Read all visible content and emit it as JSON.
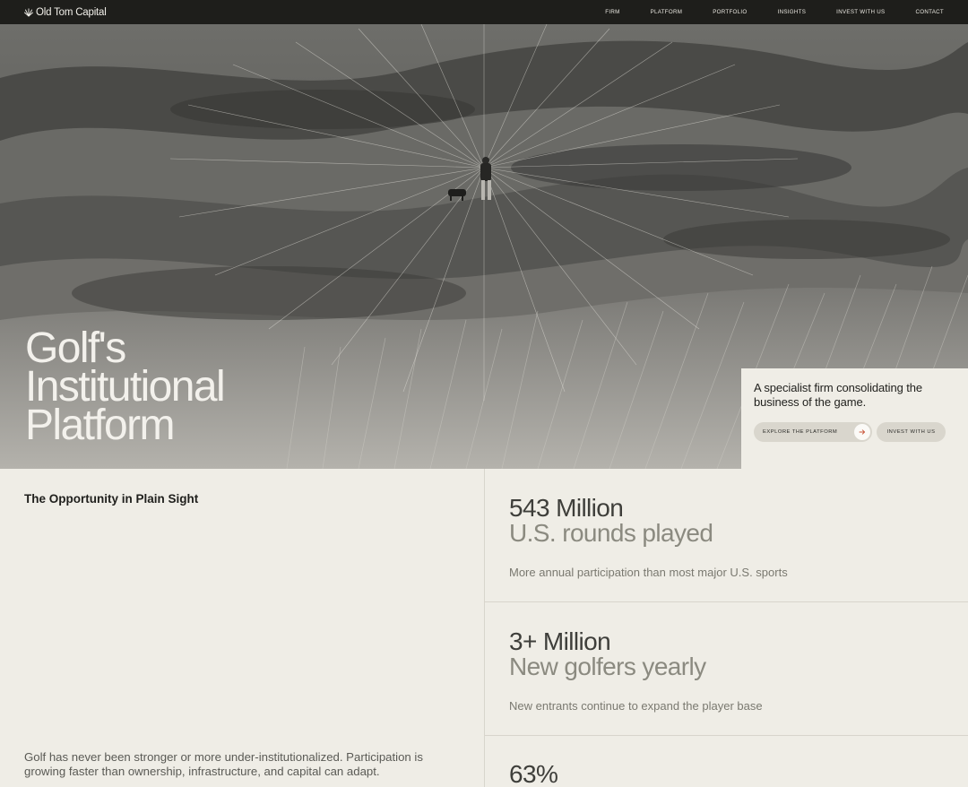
{
  "brand": {
    "name": "Old Tom Capital",
    "icon": "starburst-icon"
  },
  "nav": {
    "items": [
      {
        "label": "FIRM"
      },
      {
        "label": "PLATFORM"
      },
      {
        "label": "PORTFOLIO"
      },
      {
        "label": "INSIGHTS"
      },
      {
        "label": "INVEST WITH US"
      },
      {
        "label": "CONTACT"
      }
    ]
  },
  "hero": {
    "title_lines": [
      "Golf's",
      "Institutional",
      "Platform"
    ],
    "tagline": "A specialist firm consolidating the business of the game.",
    "explore_label": "EXPLORE THE PLATFORM",
    "invest_label": "INVEST WITH US"
  },
  "opportunity": {
    "label": "The Opportunity in Plain Sight",
    "body": "Golf has never been stronger or more under-institutionalized. Participation is growing faster than ownership, infrastructure, and capital can adapt."
  },
  "stats": [
    {
      "value": "543 Million",
      "caption": "U.S. rounds played",
      "description": "More annual participation than most major U.S. sports"
    },
    {
      "value": "3+ Million",
      "caption": "New golfers yearly",
      "description": "New entrants continue to expand the player base"
    },
    {
      "value": "63%",
      "caption": "",
      "description": ""
    }
  ],
  "colors": {
    "nav_bg": "#1e1e1b",
    "page_bg": "#efede6",
    "button_bg": "#d9d6cd",
    "accent_arrow": "#c8553a"
  }
}
